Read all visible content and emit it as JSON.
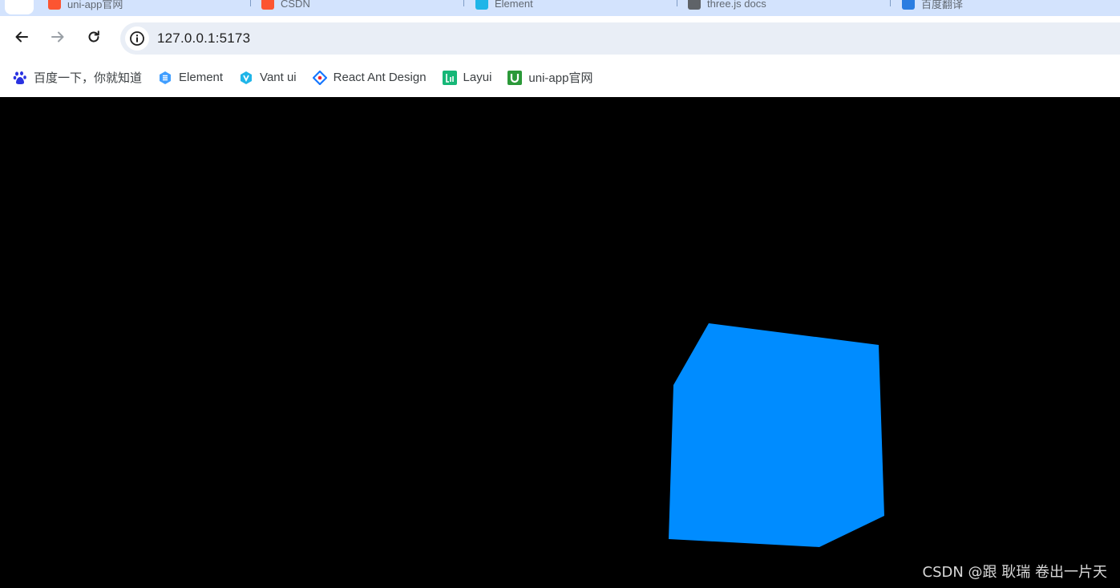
{
  "browser": {
    "tabs": [
      {
        "title": "uni-app官网",
        "favicon_color": "#fc5531"
      },
      {
        "title": "CSDN",
        "favicon_color": "#fc5531"
      },
      {
        "title": "Element",
        "favicon_color": "#1fb5e8"
      },
      {
        "title": "three.js docs",
        "favicon_color": "#5f6368"
      },
      {
        "title": "百度翻译",
        "favicon_color": "#2a7de1"
      }
    ],
    "url": "127.0.0.1:5173",
    "bookmarks": [
      {
        "label": "百度一下，你就知道",
        "icon": "baidu-paw-icon",
        "color": "#2932e1"
      },
      {
        "label": "Element",
        "icon": "element-icon",
        "color": "#409eff"
      },
      {
        "label": "Vant ui",
        "icon": "vant-icon",
        "color": "#1fb5e8"
      },
      {
        "label": "React Ant Design",
        "icon": "ant-design-icon",
        "color": "#1677ff"
      },
      {
        "label": "Layui",
        "icon": "layui-icon",
        "color": "#16b777"
      },
      {
        "label": "uni-app官网",
        "icon": "uniapp-icon",
        "color": "#2b9939"
      }
    ]
  },
  "scene": {
    "background": "#000000",
    "object": "cube",
    "cube_color": "#008cff"
  },
  "watermark": "CSDN @跟 耿瑞 卷出一片天"
}
